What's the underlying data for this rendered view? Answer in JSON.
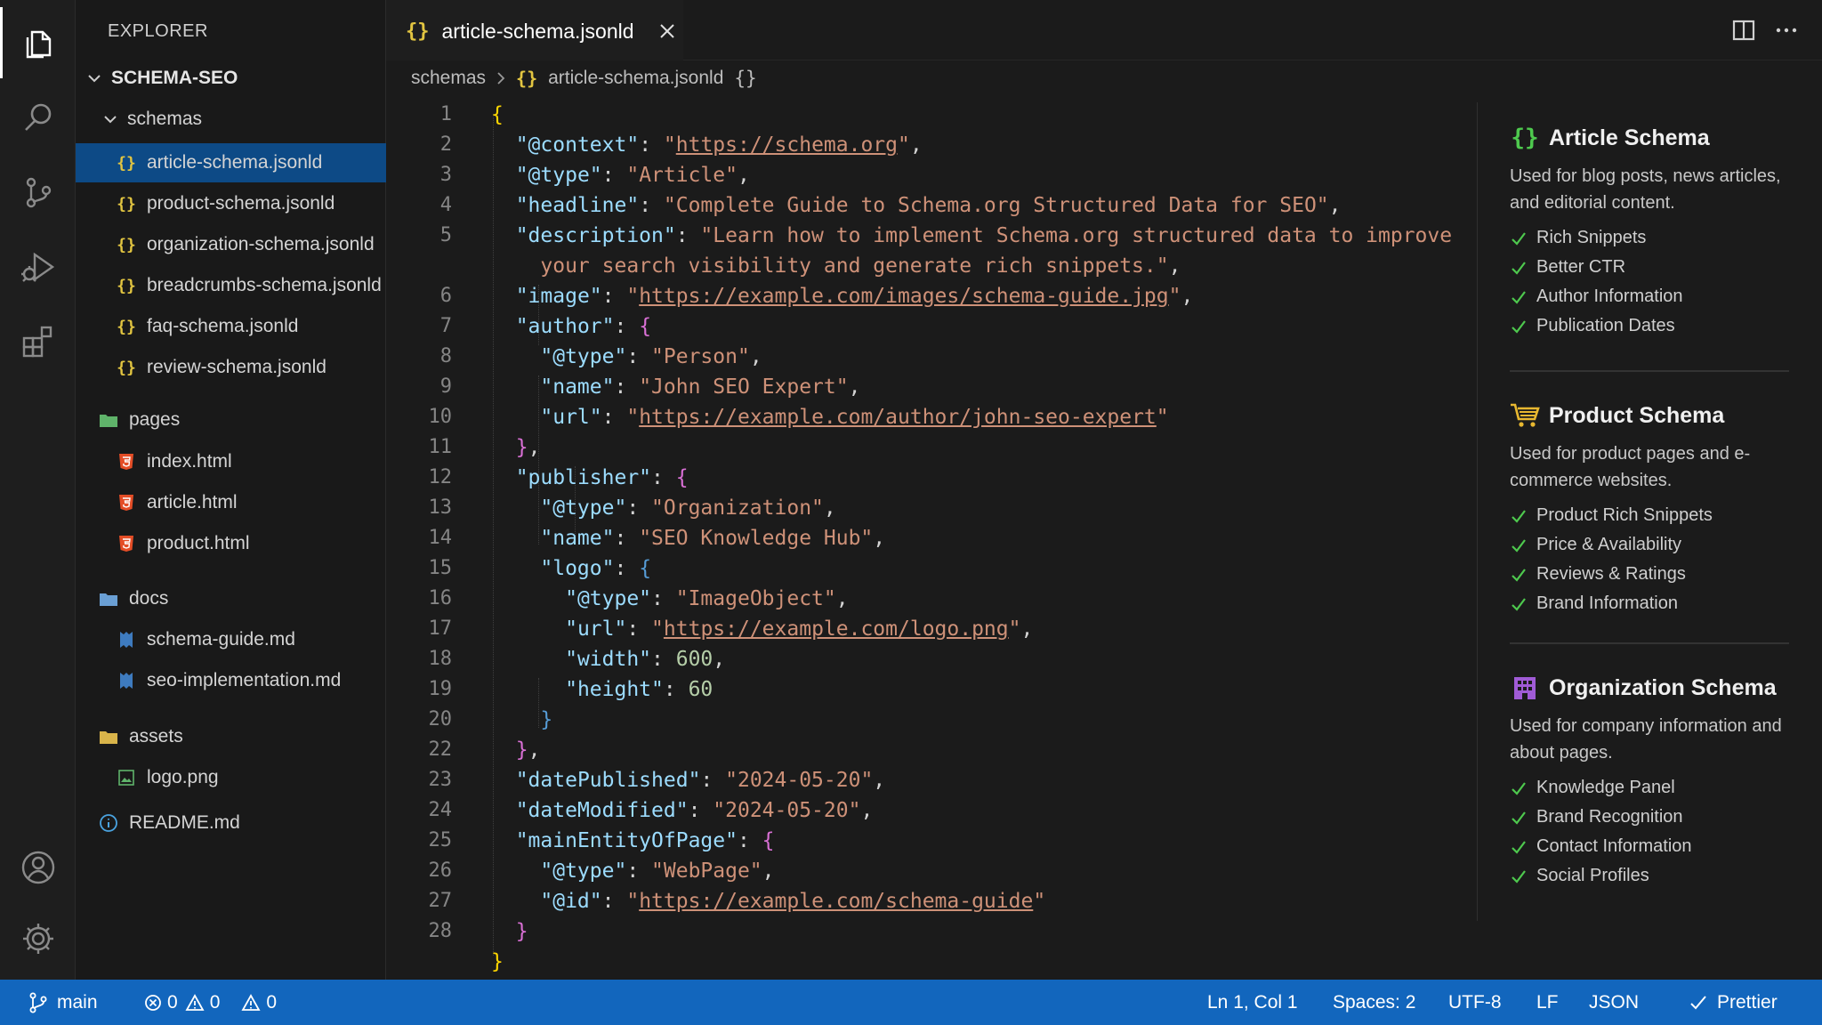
{
  "explorer": {
    "title": "EXPLORER",
    "root": "SCHEMA-SEO",
    "schemas_folder": "schemas",
    "schema_files": [
      "article-schema.jsonld",
      "product-schema.jsonld",
      "organization-schema.jsonld",
      "breadcrumbs-schema.jsonld",
      "faq-schema.jsonld",
      "review-schema.jsonld"
    ],
    "pages_folder": "pages",
    "page_files": [
      "index.html",
      "article.html",
      "product.html"
    ],
    "docs_folder": "docs",
    "doc_files": [
      "schema-guide.md",
      "seo-implementation.md"
    ],
    "assets_folder": "assets",
    "asset_files": [
      "logo.png"
    ],
    "readme": "README.md",
    "selected_file": "article-schema.jsonld"
  },
  "tab": {
    "label": "article-schema.jsonld",
    "icon": "{}"
  },
  "breadcrumb": {
    "folder": "schemas",
    "file": "article-schema.jsonld",
    "suffix": "{}"
  },
  "editor": {
    "line_numbers": [
      "1",
      "2",
      "3",
      "4",
      "5",
      "",
      "6",
      "7",
      "8",
      "9",
      "10",
      "11",
      "12",
      "13",
      "14",
      "15",
      "16",
      "17",
      "18",
      "19",
      "20",
      "22",
      "23",
      "24",
      "25",
      "26",
      "27",
      "28"
    ],
    "code": [
      "{",
      "  \"@context\": \"https://schema.org\",",
      "  \"@type\": \"Article\",",
      "  \"headline\": \"Complete Guide to Schema.org Structured Data for SEO\",",
      "  \"description\": \"Learn how to implement Schema.org structured data to improve your search visibility and generate rich snippets.\",",
      "  \"image\": \"https://example.com/images/schema-guide.jpg\",",
      "  \"author\": {",
      "    \"@type\": \"Person\",",
      "    \"name\": \"John SEO Expert\",",
      "    \"url\": \"https://example.com/author/john-seo-expert\"",
      "  },",
      "  \"publisher\": {",
      "    \"@type\": \"Organization\",",
      "    \"name\": \"SEO Knowledge Hub\",",
      "    \"logo\": {",
      "      \"@type\": \"ImageObject\",",
      "      \"url\": \"https://example.com/logo.png\",",
      "      \"width\": 600,",
      "      \"height\": 60",
      "    }",
      "  },",
      "  \"datePublished\": \"2024-05-20\",",
      "  \"dateModified\": \"2024-05-20\",",
      "  \"mainEntityOfPage\": {",
      "    \"@type\": \"WebPage\",",
      "    \"@id\": \"https://example.com/schema-guide\"",
      "  }",
      "}"
    ]
  },
  "panel": {
    "cards": [
      {
        "title": "Article Schema",
        "icon": "braces-icon",
        "description": "Used for blog posts, news articles, and editorial content.",
        "features": [
          "Rich Snippets",
          "Better CTR",
          "Author Information",
          "Publication Dates"
        ]
      },
      {
        "title": "Product Schema",
        "icon": "cart-icon",
        "description": "Used for product pages and e-commerce websites.",
        "features": [
          "Product Rich Snippets",
          "Price & Availability",
          "Reviews & Ratings",
          "Brand Information"
        ]
      },
      {
        "title": "Organization Schema",
        "icon": "building-icon",
        "description": "Used for company information and about pages.",
        "features": [
          "Knowledge Panel",
          "Brand Recognition",
          "Contact Information",
          "Social Profiles"
        ]
      }
    ]
  },
  "status": {
    "branch": "main",
    "errors": "0",
    "warnings": "0",
    "infos": "0",
    "cursor": "Ln 1, Col 1",
    "spaces": "Spaces: 2",
    "encoding": "UTF-8",
    "eol": "LF",
    "language": "JSON",
    "formatter": "Prettier"
  },
  "colors": {
    "accent": "#1266bd",
    "selection": "#0d4a86",
    "json_key": "#9cdcfe",
    "json_string": "#ce9178",
    "json_number": "#b5cea8",
    "check": "#4ec94e"
  }
}
